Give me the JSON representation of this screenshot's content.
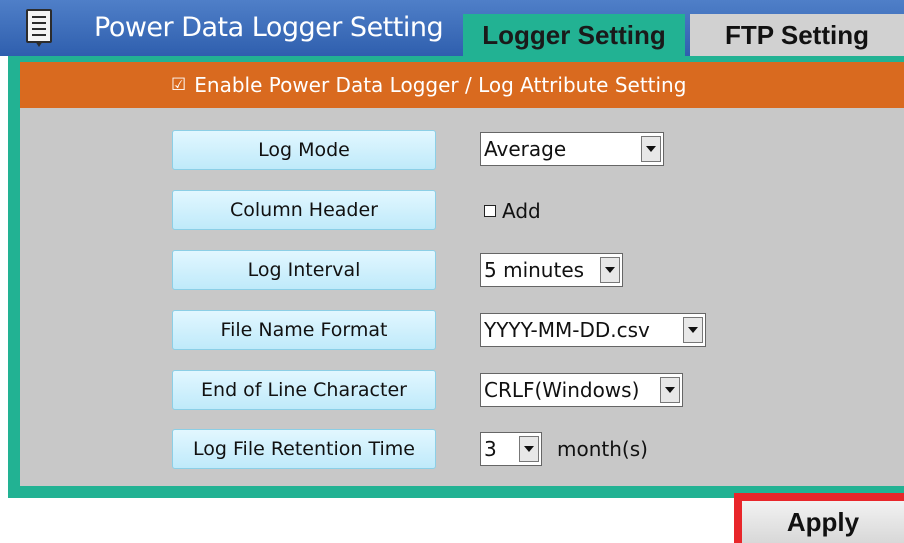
{
  "header": {
    "menu_icon": "document-menu-icon",
    "title": "Power Data Logger Setting",
    "tabs": [
      {
        "label": "Logger Setting",
        "active": true
      },
      {
        "label": "FTP Setting",
        "active": false
      }
    ]
  },
  "section": {
    "checkbox_glyph": "☑",
    "title": "Enable Power Data Logger / Log Attribute Setting"
  },
  "settings": {
    "log_mode": {
      "label": "Log Mode",
      "value": "Average"
    },
    "column_header": {
      "label": "Column Header",
      "checkbox_label": "Add",
      "checked": false
    },
    "log_interval": {
      "label": "Log Interval",
      "value": "5 minutes"
    },
    "file_name_format": {
      "label": "File Name Format",
      "value": "YYYY-MM-DD.csv"
    },
    "end_of_line": {
      "label": "End of Line Character",
      "value": "CRLF(Windows)"
    },
    "retention": {
      "label": "Log File Retention Time",
      "value": "3",
      "unit": "month(s)"
    }
  },
  "actions": {
    "apply_label": "Apply"
  },
  "colors": {
    "header": "#2f5fae",
    "active_tab": "#22b293",
    "inactive_tab": "#d1d1d1",
    "section_bar": "#d96a1f",
    "panel_bg": "#c8c8c8",
    "label_button": "#bfeafa",
    "apply_highlight": "#e8262a"
  }
}
